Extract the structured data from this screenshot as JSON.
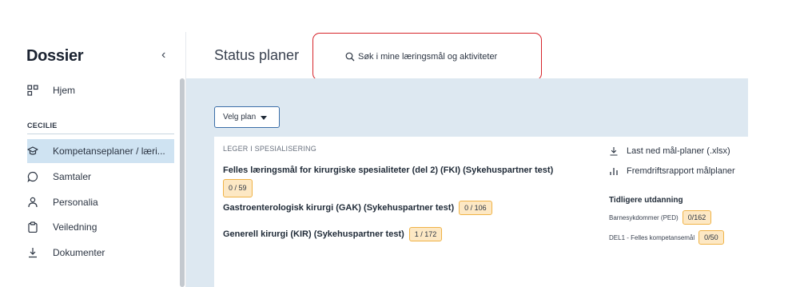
{
  "sidebar": {
    "logo": "Dossier",
    "collapse_glyph": "‹",
    "top_items": [
      {
        "label": "Hjem",
        "icon": "grid-icon"
      }
    ],
    "section_label": "CECILIE",
    "items": [
      {
        "label": "Kompetanseplaner / læri...",
        "icon": "graduation-cap-icon",
        "active": true
      },
      {
        "label": "Samtaler",
        "icon": "chat-bubble-icon"
      },
      {
        "label": "Personalia",
        "icon": "person-icon"
      },
      {
        "label": "Veiledning",
        "icon": "clipboard-icon"
      },
      {
        "label": "Dokumenter",
        "icon": "download-icon"
      }
    ]
  },
  "header": {
    "title": "Status planer",
    "search_placeholder": "Søk i mine læringsmål og aktiviteter"
  },
  "main": {
    "plan_select_label": "Velg plan",
    "section_label": "LEGER I SPESIALISERING",
    "plans": [
      {
        "name": "Felles læringsmål for kirurgiske spesialiteter (del 2) (FKI) (Sykehuspartner test)",
        "progress": "0 / 59"
      },
      {
        "name": "Gastroenterologisk kirurgi (GAK) (Sykehuspartner test)",
        "progress": "0 / 106"
      },
      {
        "name": "Generell kirurgi (KIR) (Sykehuspartner test)",
        "progress": "1 / 172"
      }
    ],
    "links": {
      "download": "Last ned mål-planer (.xlsx)",
      "report": "Fremdriftsrapport målplaner"
    },
    "previous": {
      "title": "Tidligere utdanning",
      "items": [
        {
          "name": "Barnesykdommer (PED)",
          "progress": "0/162"
        },
        {
          "name": "DEL1 - Felles kompetansemål",
          "progress": "0/50"
        }
      ]
    }
  },
  "colors": {
    "accent": "#3b6ea8",
    "active_nav": "#cfe3f2",
    "main_bg": "#dde8f1",
    "badge_bg": "#fde8c4",
    "badge_border": "#f0b347",
    "highlight_box": "#d6242b"
  }
}
